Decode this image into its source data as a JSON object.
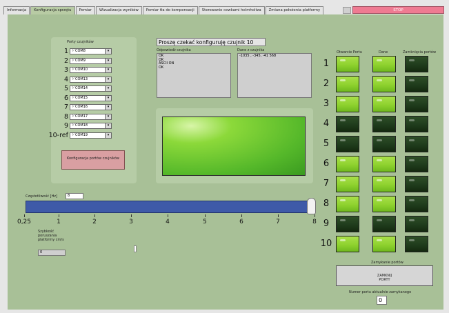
{
  "tabs": [
    "Informacja",
    "Konfiguracja sprzętu",
    "Pomiar",
    "Wizualizacja wyników",
    "Pomiar tła do kompensacji",
    "Sterowanie cewkami helmholtza",
    "Zmiana położenia platformy"
  ],
  "stop_label": "STOP",
  "ports": {
    "title": "Porty czujników",
    "labels": [
      "1",
      "2",
      "3",
      "4",
      "5",
      "6",
      "7",
      "8",
      "9",
      "10-ref"
    ],
    "values": [
      "COM8",
      "COM9",
      "COM10",
      "COM13",
      "COM14",
      "COM15",
      "COM16",
      "COM17",
      "COM18",
      "COM19"
    ],
    "config_button": "Konfiguracja portów czujników"
  },
  "status_message": "Proszę czekać konfiguruję czujnik 10",
  "response": {
    "label": "Odpowiedź czujnika",
    "text": "OK\nOK\nASCII ON\nOK"
  },
  "data": {
    "label": "Dane z czujnika",
    "text": "-1035 , -345, -41 568"
  },
  "frequency": {
    "label": "Częstotliwość [Hz]",
    "value": "8",
    "slider_ticks": [
      "0,25",
      "1",
      "2",
      "3",
      "4",
      "5",
      "6",
      "7",
      "8"
    ],
    "slider_value_fraction": 1.0
  },
  "speed": {
    "label": "Szybkość poruszania platformy cm/s",
    "value": "0"
  },
  "leds": {
    "headers": [
      "Otwarcie Portu",
      "Dane",
      "Zamknięcia portów"
    ],
    "row_labels": [
      "1",
      "2",
      "3",
      "4",
      "5",
      "6",
      "7",
      "8",
      "9",
      "10"
    ],
    "open": [
      1,
      1,
      1,
      0,
      0,
      1,
      1,
      1,
      0,
      1
    ],
    "data": [
      1,
      1,
      1,
      0,
      0,
      1,
      1,
      1,
      0,
      1
    ],
    "closed": [
      0,
      0,
      0,
      0,
      0,
      0,
      0,
      0,
      0,
      0
    ]
  },
  "closing": {
    "label": "Zamykanie portów",
    "button": "ZAMKNIJ PORTY",
    "port_label": "Numer portu aktualnie zamykanego",
    "port_value": "0"
  }
}
